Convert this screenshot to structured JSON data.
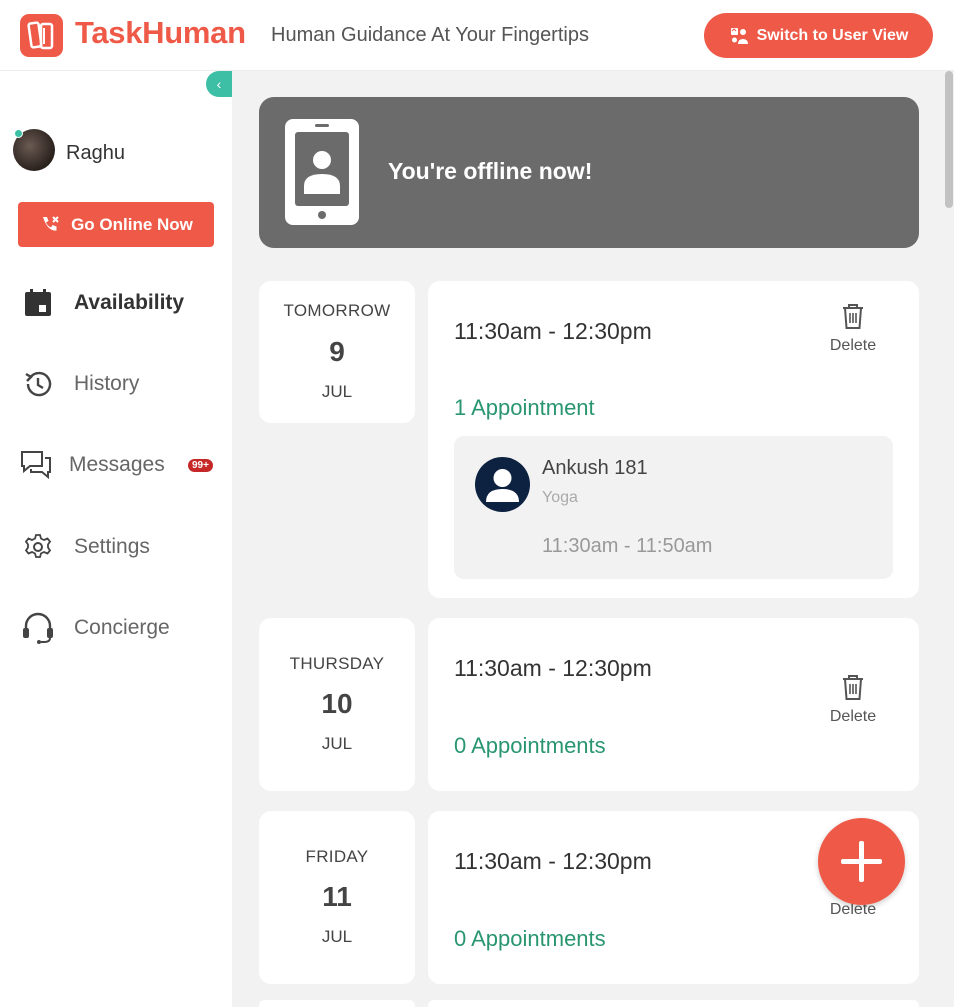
{
  "header": {
    "brand": "TaskHuman",
    "tagline": "Human Guidance At Your Fingertips",
    "switch_label": "Switch to User View"
  },
  "sidebar": {
    "username": "Raghu",
    "go_online_label": "Go Online Now",
    "items": [
      {
        "label": "Availability",
        "icon": "calendar-icon",
        "active": true
      },
      {
        "label": "History",
        "icon": "history-icon"
      },
      {
        "label": "Messages",
        "icon": "chat-icon",
        "badge": "99+"
      },
      {
        "label": "Settings",
        "icon": "gear-icon"
      },
      {
        "label": "Concierge",
        "icon": "headset-icon"
      }
    ]
  },
  "banner": {
    "text": "You're offline now!",
    "icon": "phone-user-icon"
  },
  "slots": [
    {
      "day": "TOMORROW",
      "date": "9",
      "month": "JUL",
      "time": "11:30am - 12:30pm",
      "appointments": "1 Appointment",
      "delete_label": "Delete",
      "appointment": {
        "name": "Ankush 181",
        "category": "Yoga",
        "time": "11:30am - 11:50am"
      }
    },
    {
      "day": "THURSDAY",
      "date": "10",
      "month": "JUL",
      "time": "11:30am - 12:30pm",
      "appointments": "0 Appointments",
      "delete_label": "Delete"
    },
    {
      "day": "FRIDAY",
      "date": "11",
      "month": "JUL",
      "time": "11:30am - 12:30pm",
      "appointments": "0 Appointments",
      "delete_label": "Delete"
    }
  ],
  "colors": {
    "accent": "#ef5a48",
    "teal": "#3cbfa4",
    "green_text": "#2a9670",
    "banner": "#6b6b6b"
  }
}
